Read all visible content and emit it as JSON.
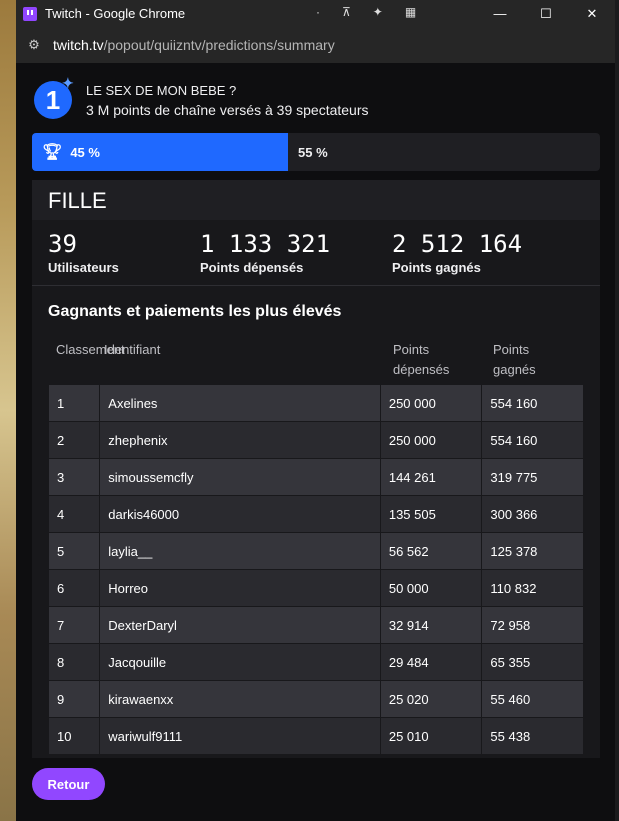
{
  "window": {
    "title": "Twitch - Google Chrome",
    "url_host": "twitch.tv",
    "url_path": "/popout/quiizntv/predictions/summary"
  },
  "prediction": {
    "rank": "1",
    "question": "LE SEX DE MON BEBE ?",
    "subtitle": "3 M points de chaîne versés à 39 spectateurs",
    "left_pct_label": "45 %",
    "right_pct_label": "55 %",
    "left_fraction": 0.45
  },
  "outcome": {
    "name": "FILLE",
    "stats": [
      {
        "value": "39",
        "label": "Utilisateurs"
      },
      {
        "value": "1 133 321",
        "label": "Points dépensés"
      },
      {
        "value": "2 512 164",
        "label": "Points gagnés"
      }
    ]
  },
  "leaderboard": {
    "title": "Gagnants et paiements les plus élevés",
    "headers": {
      "rank": "Classement",
      "id": "Identifiant",
      "spent": "Points dépensés",
      "won": "Points gagnés"
    },
    "rows": [
      {
        "rank": "1",
        "name": "Axelines",
        "spent": "250 000",
        "won": "554 160"
      },
      {
        "rank": "2",
        "name": "zhephenix",
        "spent": "250 000",
        "won": "554 160"
      },
      {
        "rank": "3",
        "name": "simoussemcfly",
        "spent": "144 261",
        "won": "319 775"
      },
      {
        "rank": "4",
        "name": "darkis46000",
        "spent": "135 505",
        "won": "300 366"
      },
      {
        "rank": "5",
        "name": "laylia__",
        "spent": "56 562",
        "won": "125 378"
      },
      {
        "rank": "6",
        "name": "Horreo",
        "spent": "50 000",
        "won": "110 832"
      },
      {
        "rank": "7",
        "name": "DexterDaryl",
        "spent": "32 914",
        "won": "72 958"
      },
      {
        "rank": "8",
        "name": "Jacqouille",
        "spent": "29 484",
        "won": "65 355"
      },
      {
        "rank": "9",
        "name": "kirawaenxx",
        "spent": "25 020",
        "won": "55 460"
      },
      {
        "rank": "10",
        "name": "wariwulf9111",
        "spent": "25 010",
        "won": "55 438"
      }
    ]
  },
  "back_button": "Retour",
  "colors": {
    "blue": "#1f69ff",
    "purple": "#9147ff",
    "bg": "#0e0e10"
  }
}
